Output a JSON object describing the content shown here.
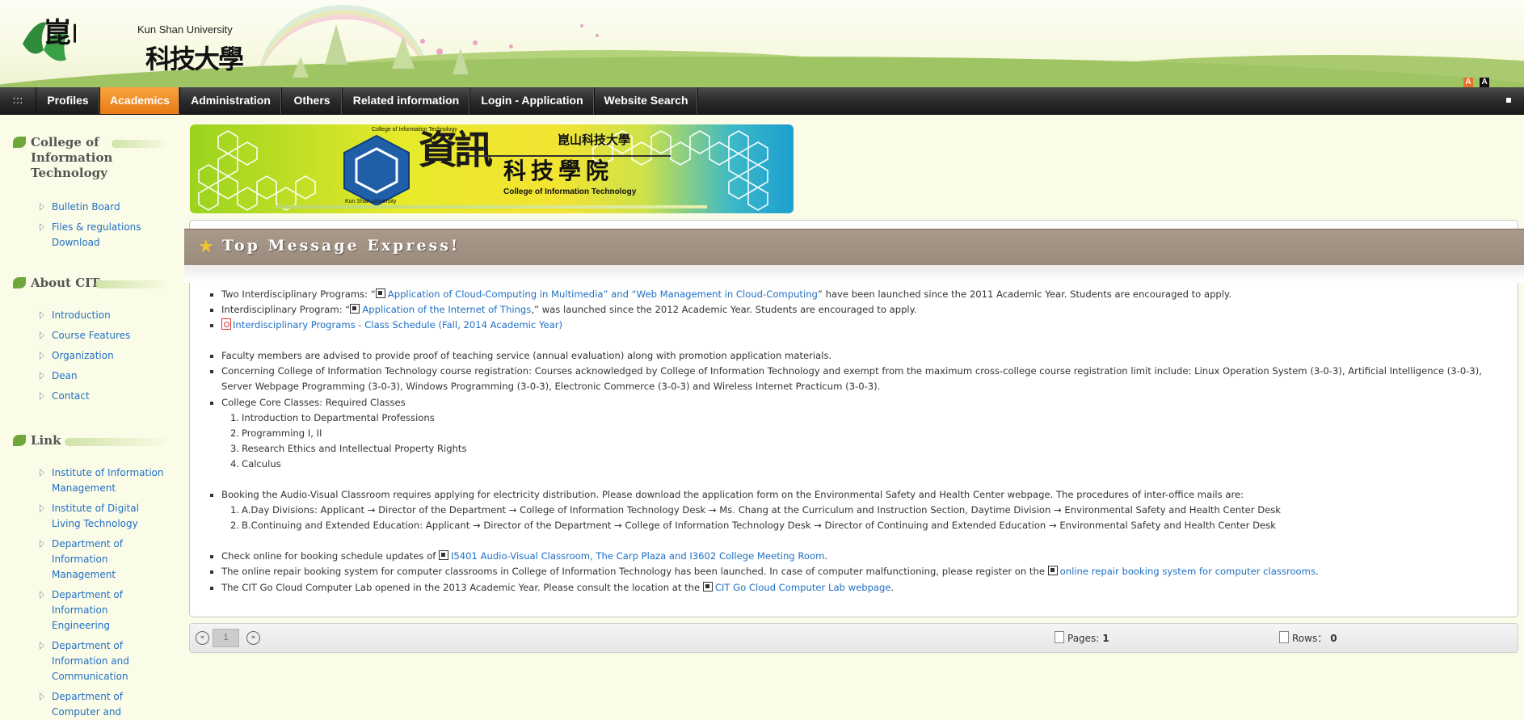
{
  "header": {
    "university_en": "Kun Shan University",
    "university_zh": "科技大學",
    "logo_chars": "崑山"
  },
  "nav": {
    "menu_icon": "grid-icon",
    "items": [
      {
        "label": "Profiles",
        "active": false
      },
      {
        "label": "Academics",
        "active": true
      },
      {
        "label": "Administration",
        "active": false
      },
      {
        "label": "Others",
        "active": false
      },
      {
        "label": "Related information",
        "active": false
      },
      {
        "label": "Login - Application",
        "active": false
      },
      {
        "label": "Website Search",
        "active": false
      }
    ],
    "accent_color": "#f08a24"
  },
  "sidebar": {
    "college": {
      "title": "College of Information Technology",
      "items": [
        "Bulletin Board",
        "Files & regulations Download"
      ]
    },
    "about": {
      "title": "About CIT",
      "items": [
        "Introduction",
        "Course Features",
        "Organization",
        "Dean",
        "Contact"
      ]
    },
    "link": {
      "title": "Link",
      "items": [
        "Institute of Information Management",
        "Institute of Digital Living Technology",
        "Department of Information Management",
        "Department of Information Engineering",
        "Department of Information and Communication",
        "Department of Computer and"
      ]
    }
  },
  "banner": {
    "zh_big": "資訊",
    "zh_small": "科技學院",
    "en": "College of Information Technology",
    "emblem_top": "College of Information Technology",
    "emblem_bottom": "Kun Shan University",
    "mini_logo": "崑山科技大學"
  },
  "messages": {
    "title": "Top Message Express!",
    "m1_pre": "Two Interdisciplinary Programs: “",
    "m1_link": "Application of Cloud-Computing in Multimedia” and “Web Management in Cloud-Computing",
    "m1_post": "” have been launched since the 2011 Academic Year. Students are encouraged to apply.",
    "m2_pre": "Interdisciplinary Program: “",
    "m2_link": "Application of the Internet of Things",
    "m2_post": ",” was launched since the 2012 Academic Year. Students are encouraged to apply.",
    "m3_link": "Interdisciplinary Programs - Class Schedule (Fall, 2014 Academic Year)",
    "m4": "Faculty members are advised to provide proof of teaching service (annual evaluation) along with promotion application materials.",
    "m5": "Concerning College of Information Technology course registration: Courses acknowledged by College of Information Technology and exempt from the maximum cross-college course registration limit include: Linux Operation System (3-0-3), Artificial Intelligence (3-0-3), Server Webpage Programming (3-0-3), Windows Programming (3-0-3), Electronic Commerce (3-0-3) and Wireless Internet Practicum (3-0-3).",
    "m6": "College Core Classes: Required Classes",
    "core": [
      "Introduction to Departmental Professions",
      "Programming I, II",
      "Research Ethics and Intellectual Property Rights",
      "Calculus"
    ],
    "m7": "Booking the Audio-Visual Classroom requires applying for electricity distribution. Please download the application form on the Environmental Safety and Health Center webpage. The procedures of inter-office mails are:",
    "procedures": [
      "A.Day Divisions: Applicant → Director of the Department → College of Information Technology Desk → Ms. Chang at the Curriculum and Instruction Section, Daytime Division → Environmental Safety and Health Center Desk",
      "B.Continuing and Extended Education: Applicant → Director of the Department → College of Information Technology Desk → Director of Continuing and Extended Education → Environmental Safety and Health Center Desk"
    ],
    "m8_pre": "Check online for booking schedule updates of ",
    "m8_link": "I5401 Audio-Visual Classroom, The Carp Plaza and I3602 College Meeting Room",
    "m8_post": ".",
    "m9_pre": "The online repair booking system for computer classrooms in College of Information Technology has been launched. In case of computer malfunctioning, please register on the ",
    "m9_link": "online repair booking system for computer classrooms",
    "m9_post": ".",
    "m10_pre": "The CIT Go Cloud Computer Lab opened in the 2013 Academic Year. Please consult the location at the ",
    "m10_link": "CIT Go Cloud Computer Lab webpage",
    "m10_post": "."
  },
  "pager": {
    "current_page": "1",
    "pages_label": "Pages:",
    "pages_value": "1",
    "rows_label": "Rows：",
    "rows_value": "0"
  },
  "font_size_buttons": [
    "A",
    "A"
  ]
}
